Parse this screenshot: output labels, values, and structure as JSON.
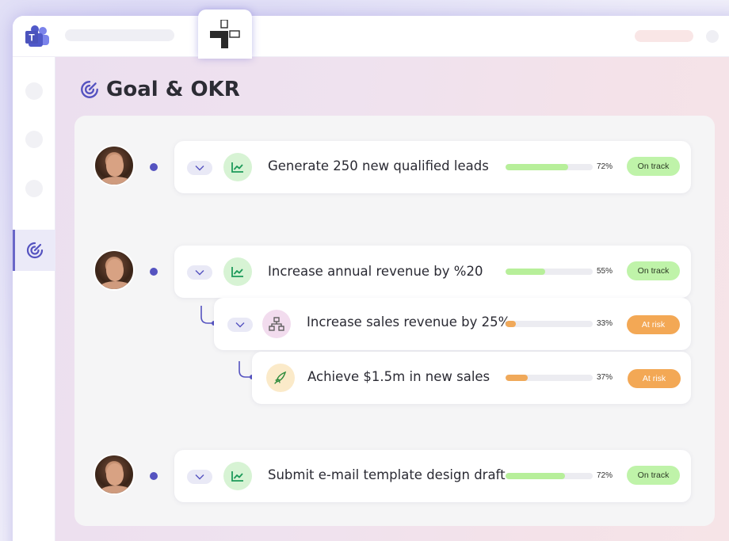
{
  "page": {
    "title": "Goal & OKR"
  },
  "colors": {
    "accent": "#5553c0",
    "on_track": "#bff3a9",
    "at_risk": "#f3a855",
    "bar_green": "#b7ef9a",
    "bar_orange": "#f0a95a"
  },
  "goals": [
    {
      "title": "Generate 250 new qualified leads",
      "progress": 0.72,
      "percent_label": "72%",
      "status": "On track",
      "icon": "chart-line-icon"
    },
    {
      "title": "Increase annual revenue by %20",
      "progress": 0.55,
      "percent_label": "55%",
      "status": "On track",
      "icon": "chart-line-icon"
    },
    {
      "title": "Increase sales revenue by 25%",
      "progress": 0.33,
      "percent_label": "33%",
      "status": "At risk",
      "icon": "org-chart-icon"
    },
    {
      "title": "Achieve $1.5m in new sales",
      "progress": 0.37,
      "percent_label": "37%",
      "status": "At risk",
      "icon": "rocket-icon"
    },
    {
      "title": "Submit e-mail template design draft",
      "progress": 0.72,
      "percent_label": "72%",
      "status": "On track",
      "icon": "chart-line-icon"
    }
  ]
}
